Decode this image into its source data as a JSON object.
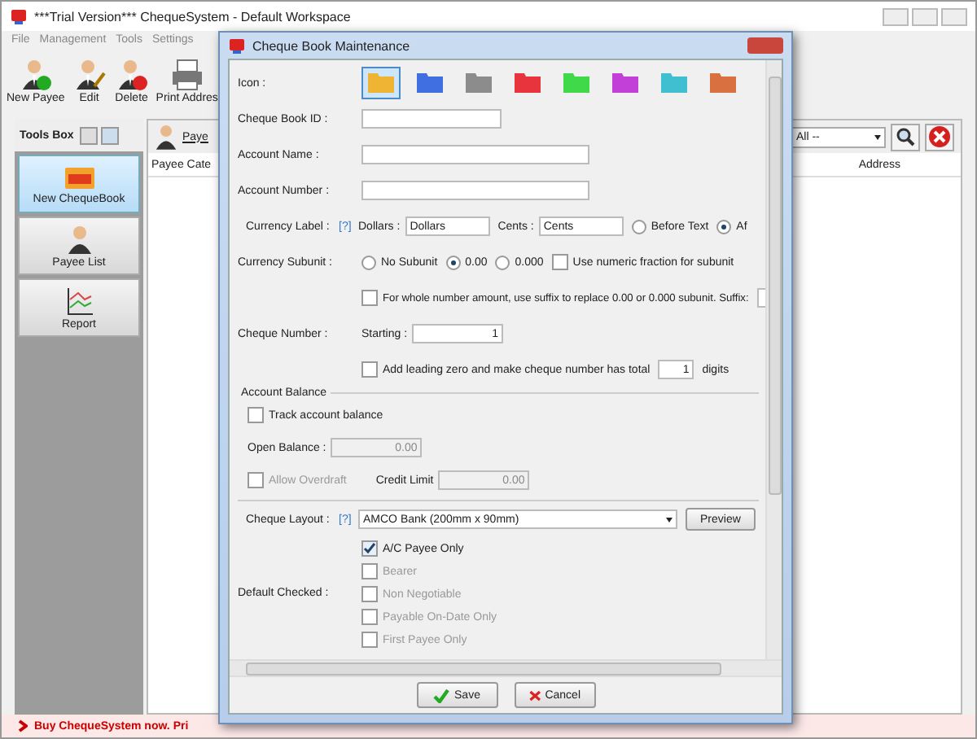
{
  "window": {
    "title": "***Trial Version*** ChequeSystem - Default Workspace"
  },
  "menu": [
    "File",
    "Management",
    "Tools",
    "Settings"
  ],
  "toolbar": [
    {
      "label": "New Payee",
      "kind": "add"
    },
    {
      "label": "Edit",
      "kind": "edit"
    },
    {
      "label": "Delete",
      "kind": "delete"
    },
    {
      "label": "Print Addres",
      "kind": "print"
    }
  ],
  "tools_box": {
    "title": "Tools Box",
    "items": [
      {
        "label": "New ChequeBook",
        "kind": "new",
        "selected": true
      },
      {
        "label": "Payee List",
        "kind": "person",
        "selected": false
      },
      {
        "label": "Report",
        "kind": "chart",
        "selected": false
      }
    ]
  },
  "payee_panel": {
    "title": "Paye",
    "filter": "All --",
    "columns": [
      "Payee Cate",
      "Address"
    ]
  },
  "status_bar": "Buy ChequeSystem now. Pri",
  "dialog": {
    "title": "Cheque Book Maintenance",
    "icon_label": "Icon :",
    "icons": [
      {
        "color": "#f0b435",
        "selected": true
      },
      {
        "color": "#3f6fe0",
        "selected": false
      },
      {
        "color": "#8c8c8c",
        "selected": false
      },
      {
        "color": "#e8343c",
        "selected": false
      },
      {
        "color": "#3fd94a",
        "selected": false
      },
      {
        "color": "#c340d8",
        "selected": false
      },
      {
        "color": "#3fbfd0",
        "selected": false
      },
      {
        "color": "#d8703f",
        "selected": false
      }
    ],
    "fields": [
      {
        "label": "Cheque Book ID :",
        "kind": "short"
      },
      {
        "label": "Account Name :",
        "kind": "long"
      },
      {
        "label": "Account Number :",
        "kind": "long"
      }
    ],
    "currency": {
      "label": "Currency Label :",
      "help": "[?]",
      "dollars_label": "Dollars :",
      "dollars": "Dollars",
      "cents_label": "Cents :",
      "cents": "Cents",
      "positions": [
        {
          "label": "Before Text",
          "selected": false
        },
        {
          "label": "Af",
          "selected": true
        }
      ]
    },
    "subunit": {
      "label": "Currency Subunit :",
      "options": [
        {
          "label": "No Subunit",
          "selected": false
        },
        {
          "label": "0.00",
          "selected": true
        },
        {
          "label": "0.000",
          "selected": false
        }
      ],
      "fraction": {
        "label": "Use numeric fraction for subunit",
        "checked": false
      },
      "suffix": {
        "label": "For whole number amount, use suffix to replace 0.00 or 0.000 subunit. Suffix:",
        "checked": false
      }
    },
    "cheque_number": {
      "label": "Cheque Number :",
      "starting_label": "Starting :",
      "starting": "1",
      "leading_zero": {
        "label": "Add leading zero and make cheque number has total",
        "checked": false
      },
      "digits": "1",
      "digits_label": "digits"
    },
    "balance": {
      "title": "Account Balance",
      "track": {
        "label": "Track account balance",
        "checked": false
      },
      "open_label": "Open Balance :",
      "open": {
        "value": "0.00",
        "disabled": true
      },
      "overdraft": {
        "label": "Allow Overdraft",
        "checked": false,
        "disabled": true
      },
      "credit_label": "Credit Limit",
      "credit": "0.00"
    },
    "layout": {
      "label": "Cheque Layout :",
      "help": "[?]",
      "value": "AMCO Bank (200mm x 90mm)",
      "preview": "Preview"
    },
    "default_checked": {
      "label": "Default Checked :",
      "items": [
        {
          "label": "A/C Payee Only",
          "checked": true,
          "disabled": false
        },
        {
          "label": "Bearer",
          "checked": false,
          "disabled": true
        },
        {
          "label": "Non Negotiable",
          "checked": false,
          "disabled": true
        },
        {
          "label": "Payable On-Date Only",
          "checked": false,
          "disabled": true
        },
        {
          "label": "First Payee Only",
          "checked": false,
          "disabled": true
        }
      ]
    },
    "buttons": [
      {
        "label": "Save",
        "kind": "save"
      },
      {
        "label": "Cancel",
        "kind": "cancel"
      }
    ]
  }
}
